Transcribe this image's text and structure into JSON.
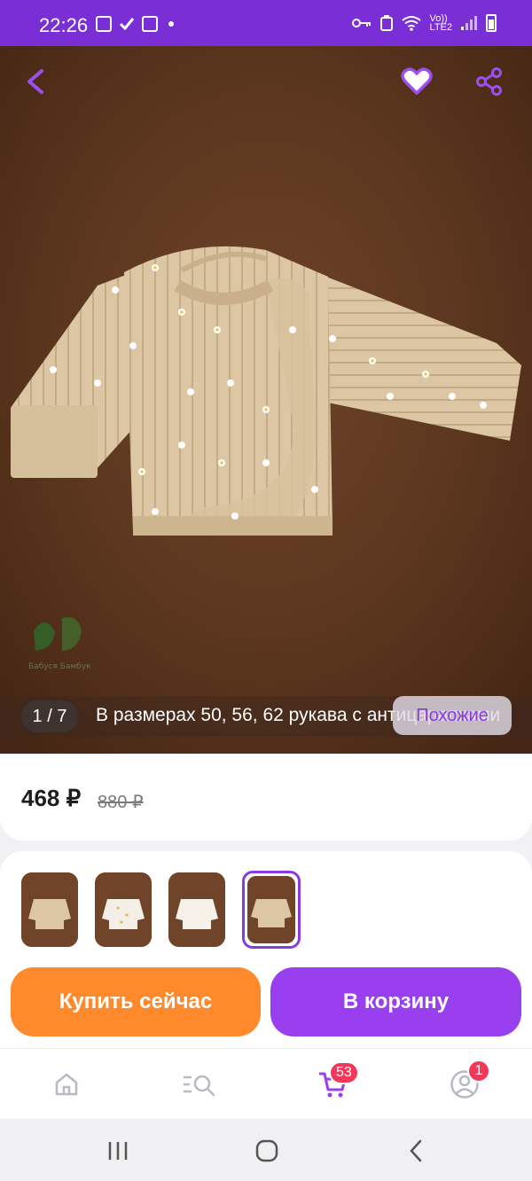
{
  "status_bar": {
    "time": "22:26",
    "signal_text": "Vo))\nLTE2"
  },
  "product": {
    "image_counter": "1 / 7",
    "caption": "В размерах 50, 56, 62 рукава с антицарапками",
    "similar_button": "Похожие",
    "price": "468 ₽",
    "old_price": "880 ₽",
    "brand_watermark": "Бабуся Бамбук"
  },
  "actions": {
    "buy_now": "Купить сейчас",
    "add_to_cart": "В корзину"
  },
  "bottom_nav": {
    "cart_badge": "53",
    "profile_badge": "1"
  },
  "colors": {
    "accent": "#9a3ff0",
    "status_bar": "#7a2fd6",
    "buy": "#ff8a2c",
    "badge": "#f2385a"
  },
  "variants": [
    {
      "name": "beige-floral-top"
    },
    {
      "name": "white-dot-top"
    },
    {
      "name": "white-top"
    },
    {
      "name": "beige-floral-selected"
    }
  ]
}
